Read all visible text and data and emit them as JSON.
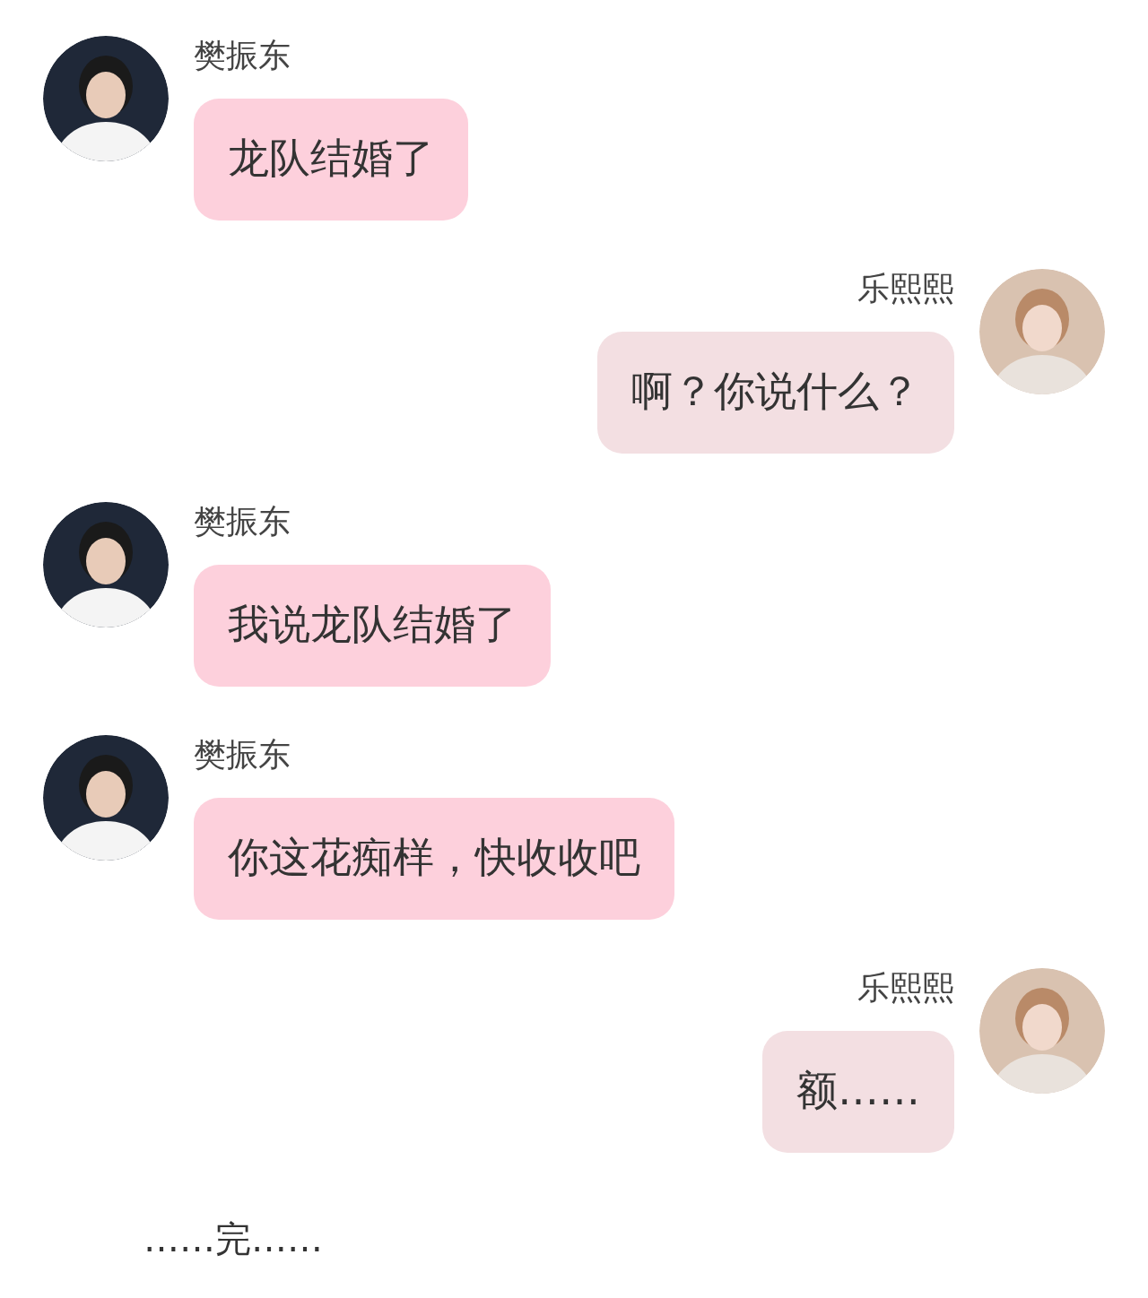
{
  "messages": [
    {
      "kind": "incoming",
      "name": "樊振东",
      "text": "龙队结婚了"
    },
    {
      "kind": "outgoing",
      "name": "乐熙熙",
      "text": "啊？你说什么？"
    },
    {
      "kind": "incoming",
      "name": "樊振东",
      "text": "我说龙队结婚了"
    },
    {
      "kind": "incoming",
      "name": "樊振东",
      "text": "你这花痴样，快收收吧"
    },
    {
      "kind": "outgoing",
      "name": "乐熙熙",
      "text": "额……"
    }
  ],
  "footer": "……完……"
}
